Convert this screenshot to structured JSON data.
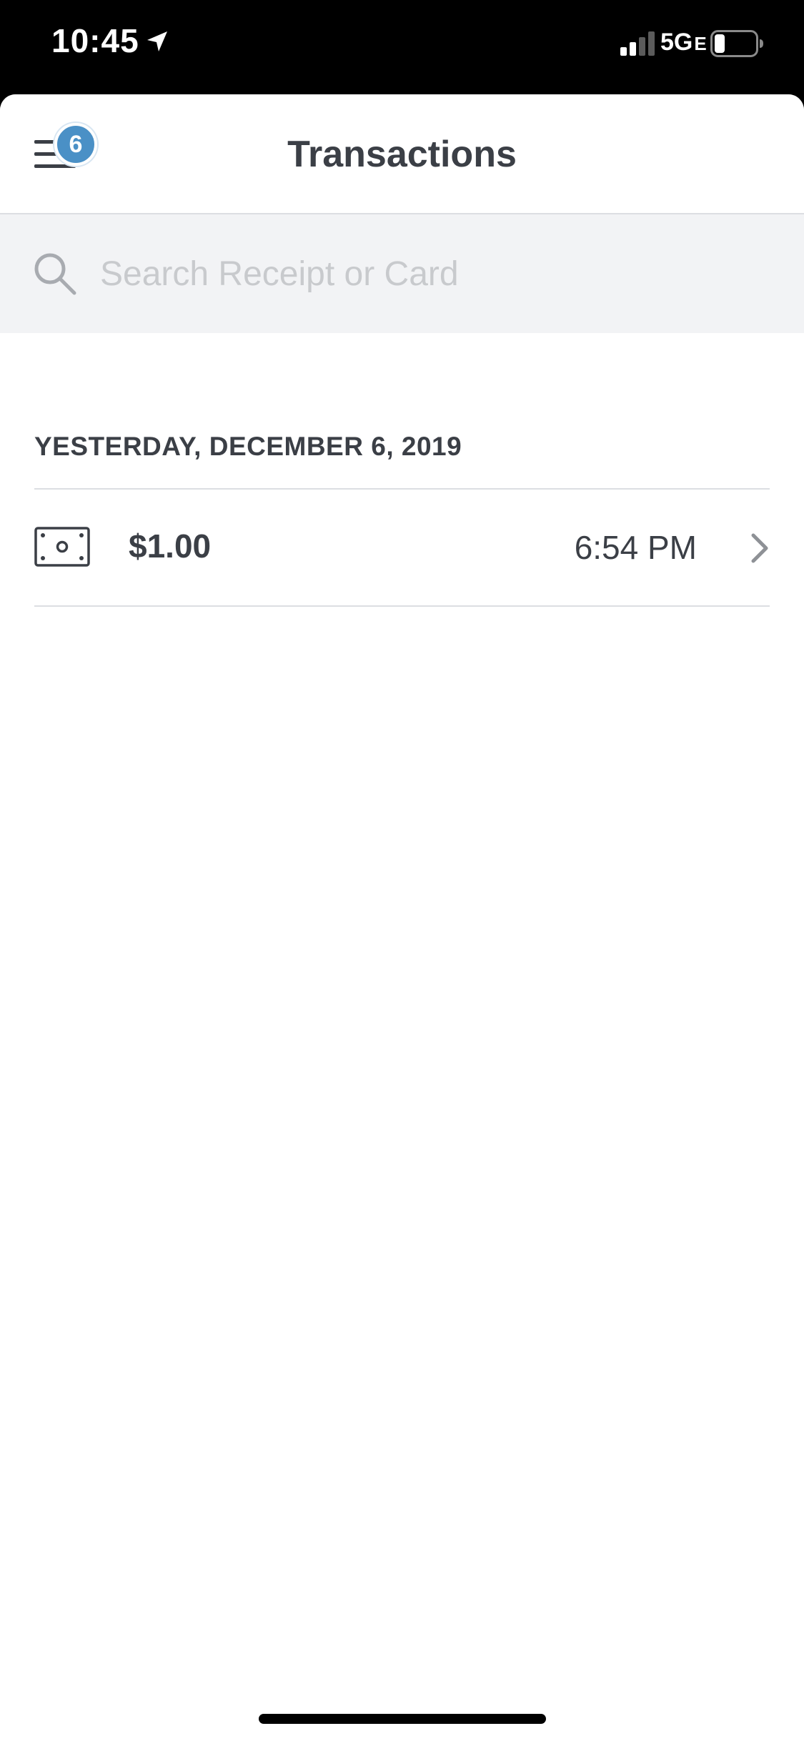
{
  "status_bar": {
    "time": "10:45",
    "network": "5G",
    "network_suffix": "E",
    "icons": [
      "location-arrow-icon",
      "signal-bars-icon",
      "battery-icon"
    ]
  },
  "nav": {
    "title": "Transactions",
    "menu_icon": "hamburger-menu-icon",
    "badge_count": "6",
    "badge_color": "#4a90c6"
  },
  "search": {
    "placeholder": "Search Receipt or Card",
    "value": "",
    "icon": "search-icon"
  },
  "transactions": {
    "section_header": "YESTERDAY, DECEMBER 6, 2019",
    "items": [
      {
        "icon": "cash-icon",
        "amount": "$1.00",
        "time": "6:54 PM",
        "trailing_icon": "chevron-right-icon"
      }
    ]
  },
  "colors": {
    "text_primary": "#3b3f46",
    "search_bg": "#f2f3f5",
    "divider": "#dcdee2",
    "placeholder": "#c8cacd"
  }
}
